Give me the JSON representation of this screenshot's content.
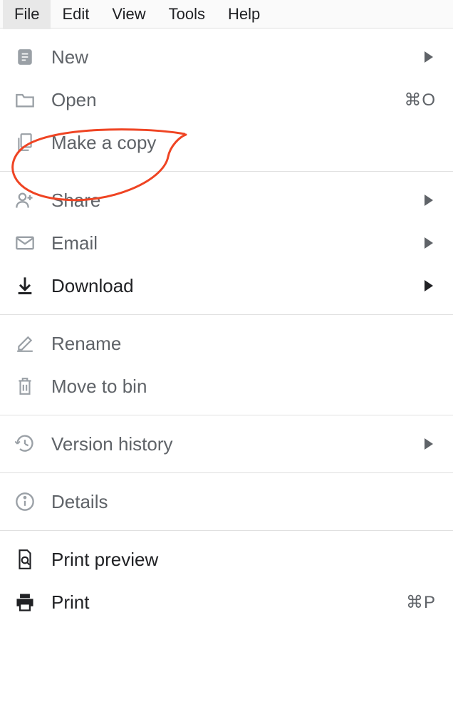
{
  "menubar": {
    "items": [
      {
        "label": "File",
        "active": true
      },
      {
        "label": "Edit",
        "active": false
      },
      {
        "label": "View",
        "active": false
      },
      {
        "label": "Tools",
        "active": false
      },
      {
        "label": "Help",
        "active": false
      }
    ]
  },
  "menu": {
    "groups": [
      [
        {
          "icon": "doc-icon",
          "label": "New",
          "submenu": true
        },
        {
          "icon": "folder-icon",
          "label": "Open",
          "shortcut": "⌘O"
        },
        {
          "icon": "copy-icon",
          "label": "Make a copy"
        }
      ],
      [
        {
          "icon": "person-add-icon",
          "label": "Share",
          "submenu": true
        },
        {
          "icon": "mail-icon",
          "label": "Email",
          "submenu": true
        },
        {
          "icon": "download-icon",
          "label": "Download",
          "submenu": true,
          "emphasized": true
        }
      ],
      [
        {
          "icon": "pencil-icon",
          "label": "Rename"
        },
        {
          "icon": "trash-icon",
          "label": "Move to bin"
        }
      ],
      [
        {
          "icon": "history-icon",
          "label": "Version history",
          "submenu": true
        }
      ],
      [
        {
          "icon": "info-icon",
          "label": "Details"
        }
      ],
      [
        {
          "icon": "print-preview-icon",
          "label": "Print preview",
          "emphasized": true
        },
        {
          "icon": "print-icon",
          "label": "Print",
          "shortcut": "⌘P",
          "emphasized": true
        }
      ]
    ]
  }
}
